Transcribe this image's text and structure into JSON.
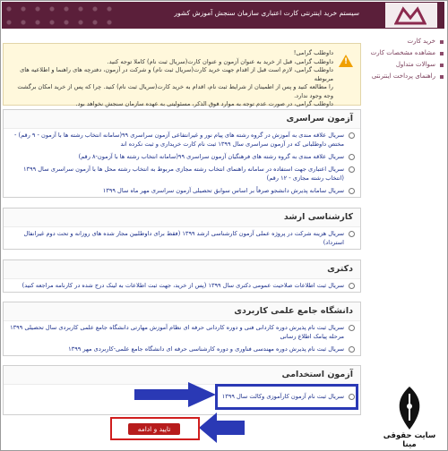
{
  "header": {
    "title": "سیستم خرید اینترنتی کارت اعتباری سازمان سنجش آموزش کشور"
  },
  "sidebar": {
    "items": [
      {
        "label": "خرید کارت"
      },
      {
        "label": "مشاهده مشخصات کارت"
      },
      {
        "label": "سوالات متداول"
      },
      {
        "label": "راهنمای پرداخت اینترنتی"
      }
    ]
  },
  "notice": {
    "lines": [
      "داوطلب گرامی!",
      "داوطلب گرامی، قبل از خرید به عنوان آزمون و عنوان کارت(سریال ثبت نام) کاملا توجه کنید.",
      "داوطلب گرامی، لازم است قبل از اقدام جهت خرید کارت(سریال ثبت نام) و شرکت در آزمون، دفترچه های راهنما و اطلاعیه های مربوطه",
      "را مطالعه کنید و پس از اطمینان از شرایط ثبت نام، اقدام به خرید کارت(سریال ثبت نام) کنید. چرا که پس از خرید امکان برگشت وجه وجود ندارد.",
      "داوطلب گرامی، در صورت عدم توجه به موارد فوق الذکر، مسئولیتی به عهده سازمان سنجش نخواهد بود."
    ]
  },
  "sections": [
    {
      "title": "آزمون سراسری",
      "options": [
        "سریال علاقه مندی به آموزش در گروه رشته های پیام نور و غیرانتفاعی آزمون سراسری ۹۹(سامانه انتخاب رشته ها با آزمون - ۹ رقم) - مختص داوطلبانی که در آزمون سراسری سال ۱۳۹۹ ثبت نام کارت خریداری و ثبت نکرده اند",
        "سریال علاقه مندی به گروه رشته های فرهنگیان آزمون سراسری ۹۹(سامانه انتخاب رشته ها با آزمون-۸ رقم)",
        "سریال اعتباری جهت استفاده در سامانه راهنمای انتخاب رشته مجازی مربوط به انتخاب رشته محل ها با آزمون سراسری سال ۱۳۹۹ (انتخاب رشته مجازی - ۱۲ رقم)",
        "سریال سامانه پذیرش دانشجو صرفاً بر اساس سوابق تحصیلی آزمون سراسری مهر ماه سال ۱۳۹۹"
      ]
    },
    {
      "title": "کارشناسی ارشد",
      "options": [
        "سریال هزینه شرکت در پروژه عملی آزمون کارشناسی ارشد ۱۳۹۹ (فقط برای داوطلبین مجاز شده های روزانه و تحت دوم غیرانفال استرداد)"
      ]
    },
    {
      "title": "دکتری",
      "options": [
        "سریال ثبت اطلاعات صلاحیت عمومی دکتری سال ۱۳۹۹ (پس از خرید، جهت ثبت اطلاعات به لینک درج شده در کارنامه مراجعه کنید)"
      ]
    },
    {
      "title": "دانشگاه جامع علمی کاربردی",
      "options": [
        "سریال ثبت نام پذیرش دوره کاردانی فنی و دوره کاردانی حرفه ای نظام آموزش مهارتی دانشگاه جامع علمی کاربردی سال تحصیلی ۱۳۹۹ مرحله پیامک اطلاع رسانی",
        "سریال ثبت نام پذیرش دوره مهندسی فناوری و دوره کارشناسی حرفه ای دانشگاه جامع علمی-کاربردی مهر ۱۳۹۹"
      ]
    },
    {
      "title": "آزمون استخدامی",
      "options": [
        "سریال ثبت نام آزمون کارآموزی وکالت سال ۱۳۹۹"
      ]
    }
  ],
  "submit": {
    "label": "تایید و ادامه"
  },
  "watermark": {
    "text": "سایت حقوقی مینا"
  },
  "colors": {
    "header": "#5b1f3a",
    "link": "#1a2e8a",
    "highlight": "#2a39b5",
    "button": "#b71c1c",
    "warning": "#f0a000"
  }
}
